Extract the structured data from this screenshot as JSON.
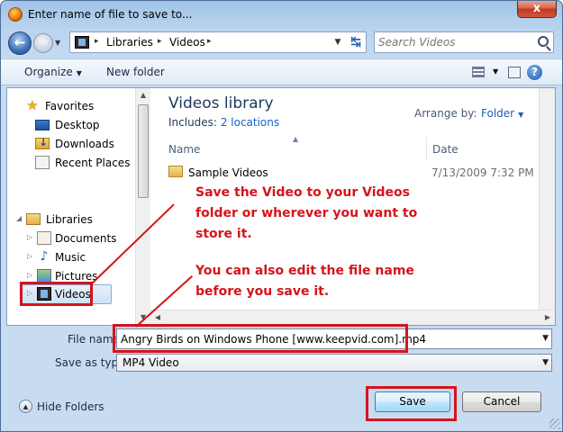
{
  "window": {
    "title": "Enter name of file to save to...",
    "close_glyph": "x"
  },
  "address": {
    "crumbs": [
      "Libraries",
      "Videos"
    ],
    "separator": "▸",
    "refresh_glyph": "↹"
  },
  "search": {
    "placeholder": "Search Videos"
  },
  "toolbar": {
    "organize_label": "Organize",
    "new_folder_label": "New folder",
    "help_glyph": "?"
  },
  "sidebar": {
    "favorites": {
      "label": "Favorites",
      "items": [
        {
          "label": "Desktop",
          "icon": "desktop-icon"
        },
        {
          "label": "Downloads",
          "icon": "downloads-icon"
        },
        {
          "label": "Recent Places",
          "icon": "recent-places-icon"
        }
      ]
    },
    "libraries": {
      "label": "Libraries",
      "items": [
        {
          "label": "Documents",
          "icon": "documents-icon"
        },
        {
          "label": "Music",
          "icon": "music-icon"
        },
        {
          "label": "Pictures",
          "icon": "pictures-icon"
        },
        {
          "label": "Videos",
          "icon": "videos-icon",
          "selected": true
        }
      ]
    }
  },
  "library": {
    "title": "Videos library",
    "includes_label": "Includes:",
    "includes_link": "2 locations",
    "arrange_label": "Arrange by:",
    "arrange_value": "Folder"
  },
  "columns": {
    "name": "Name",
    "date": "Date"
  },
  "files": [
    {
      "name": "Sample Videos",
      "date": "7/13/2009 7:32 PM",
      "icon": "folder-icon"
    }
  ],
  "form": {
    "filename_label": "File name:",
    "filename_value": "Angry Birds on Windows Phone [www.keepvid.com].mp4",
    "savetype_label": "Save as type:",
    "savetype_value": "MP4 Video"
  },
  "footer": {
    "hide_folders_label": "Hide Folders",
    "save_label": "Save",
    "cancel_label": "Cancel"
  },
  "annotations": {
    "line1": "Save the Video to your Videos",
    "line2": "folder or wherever you want to",
    "line3": "store it.",
    "line4": "You can also edit the file name",
    "line5": "before you save it."
  },
  "colors": {
    "annotation_red": "#d4141a",
    "link_blue": "#0e62c7",
    "title_blue": "#1e395b"
  }
}
